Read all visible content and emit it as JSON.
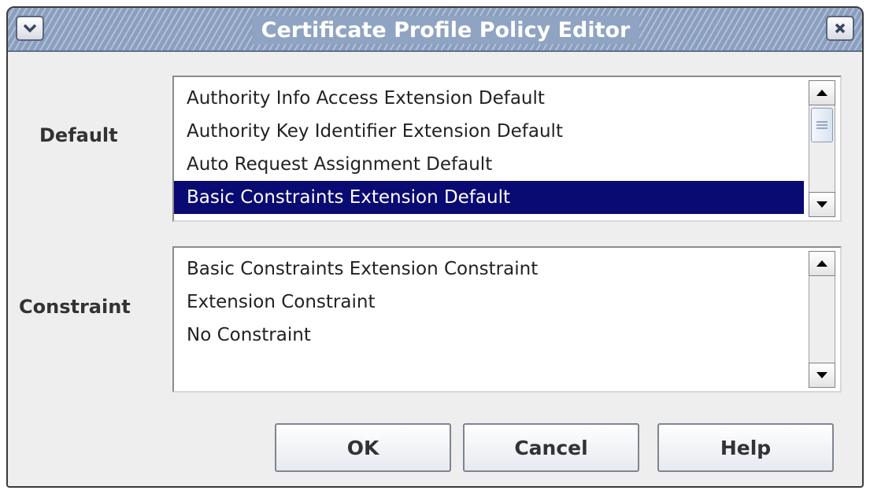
{
  "window": {
    "title": "Certificate Profile Policy Editor",
    "accent": "#0a0a73"
  },
  "default_section": {
    "label": "Default",
    "items": [
      {
        "label": "Authority Info Access Extension Default",
        "selected": false
      },
      {
        "label": "Authority Key Identifier Extension Default",
        "selected": false
      },
      {
        "label": "Auto Request Assignment Default",
        "selected": false
      },
      {
        "label": "Basic Constraints Extension Default",
        "selected": true
      }
    ]
  },
  "constraint_section": {
    "label": "Constraint",
    "items": [
      {
        "label": "Basic Constraints Extension Constraint",
        "selected": false
      },
      {
        "label": "Extension Constraint",
        "selected": false
      },
      {
        "label": "No Constraint",
        "selected": false
      }
    ]
  },
  "buttons": {
    "ok": "OK",
    "cancel": "Cancel",
    "help": "Help"
  },
  "icons": {
    "window_menu": "chevron-down-icon",
    "close": "close-icon",
    "scroll_up": "triangle-up-icon",
    "scroll_down": "triangle-down-icon",
    "scroll_thumb_grip": "grip-lines-icon"
  }
}
